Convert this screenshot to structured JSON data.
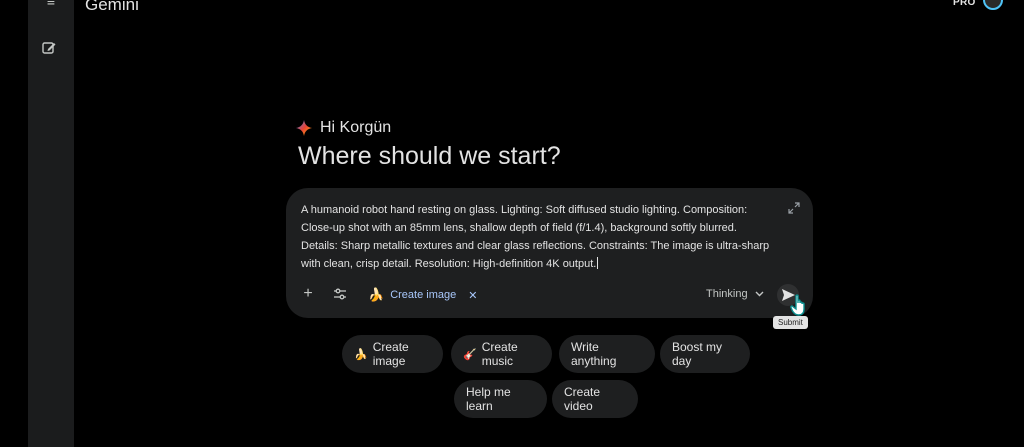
{
  "app": {
    "title": "Gemini",
    "plan_badge": "PRO"
  },
  "sidebar": {
    "menu_icon": "menu-icon",
    "new_chat_icon": "edit-square-icon"
  },
  "greeting": {
    "icon": "gemini-sparkle-icon",
    "text": "Hi Korgün",
    "headline": "Where should we start?"
  },
  "prompt": {
    "value": "A humanoid robot hand resting on glass. Lighting: Soft diffused studio lighting. Composition: Close-up shot with an 85mm lens, shallow depth of field (f/1.4), background softly blurred. Details: Sharp metallic textures and clear glass reflections. Constraints: The image is ultra-sharp with clean, crisp detail. Resolution: High-definition 4K output."
  },
  "toolbar": {
    "add_icon": "plus-icon",
    "tools_icon": "tools-icon",
    "chip": {
      "icon": "banana-icon",
      "label": "Create image",
      "close_icon": "close-icon"
    },
    "mode": {
      "label": "Thinking",
      "icon": "chevron-down-icon"
    },
    "send": {
      "icon": "send-icon",
      "tooltip": "Submit"
    }
  },
  "suggestions": [
    {
      "icon": "🍌",
      "label": "Create image"
    },
    {
      "icon": "🎸",
      "label": "Create music"
    },
    {
      "icon": "",
      "label": "Write anything"
    },
    {
      "icon": "",
      "label": "Boost my day"
    },
    {
      "icon": "",
      "label": "Help me learn"
    },
    {
      "icon": "",
      "label": "Create video"
    }
  ],
  "colors": {
    "background": "#000000",
    "surface": "#1e1f20",
    "sidebar": "#1b1c1d",
    "accent": "#a8c7fa"
  }
}
